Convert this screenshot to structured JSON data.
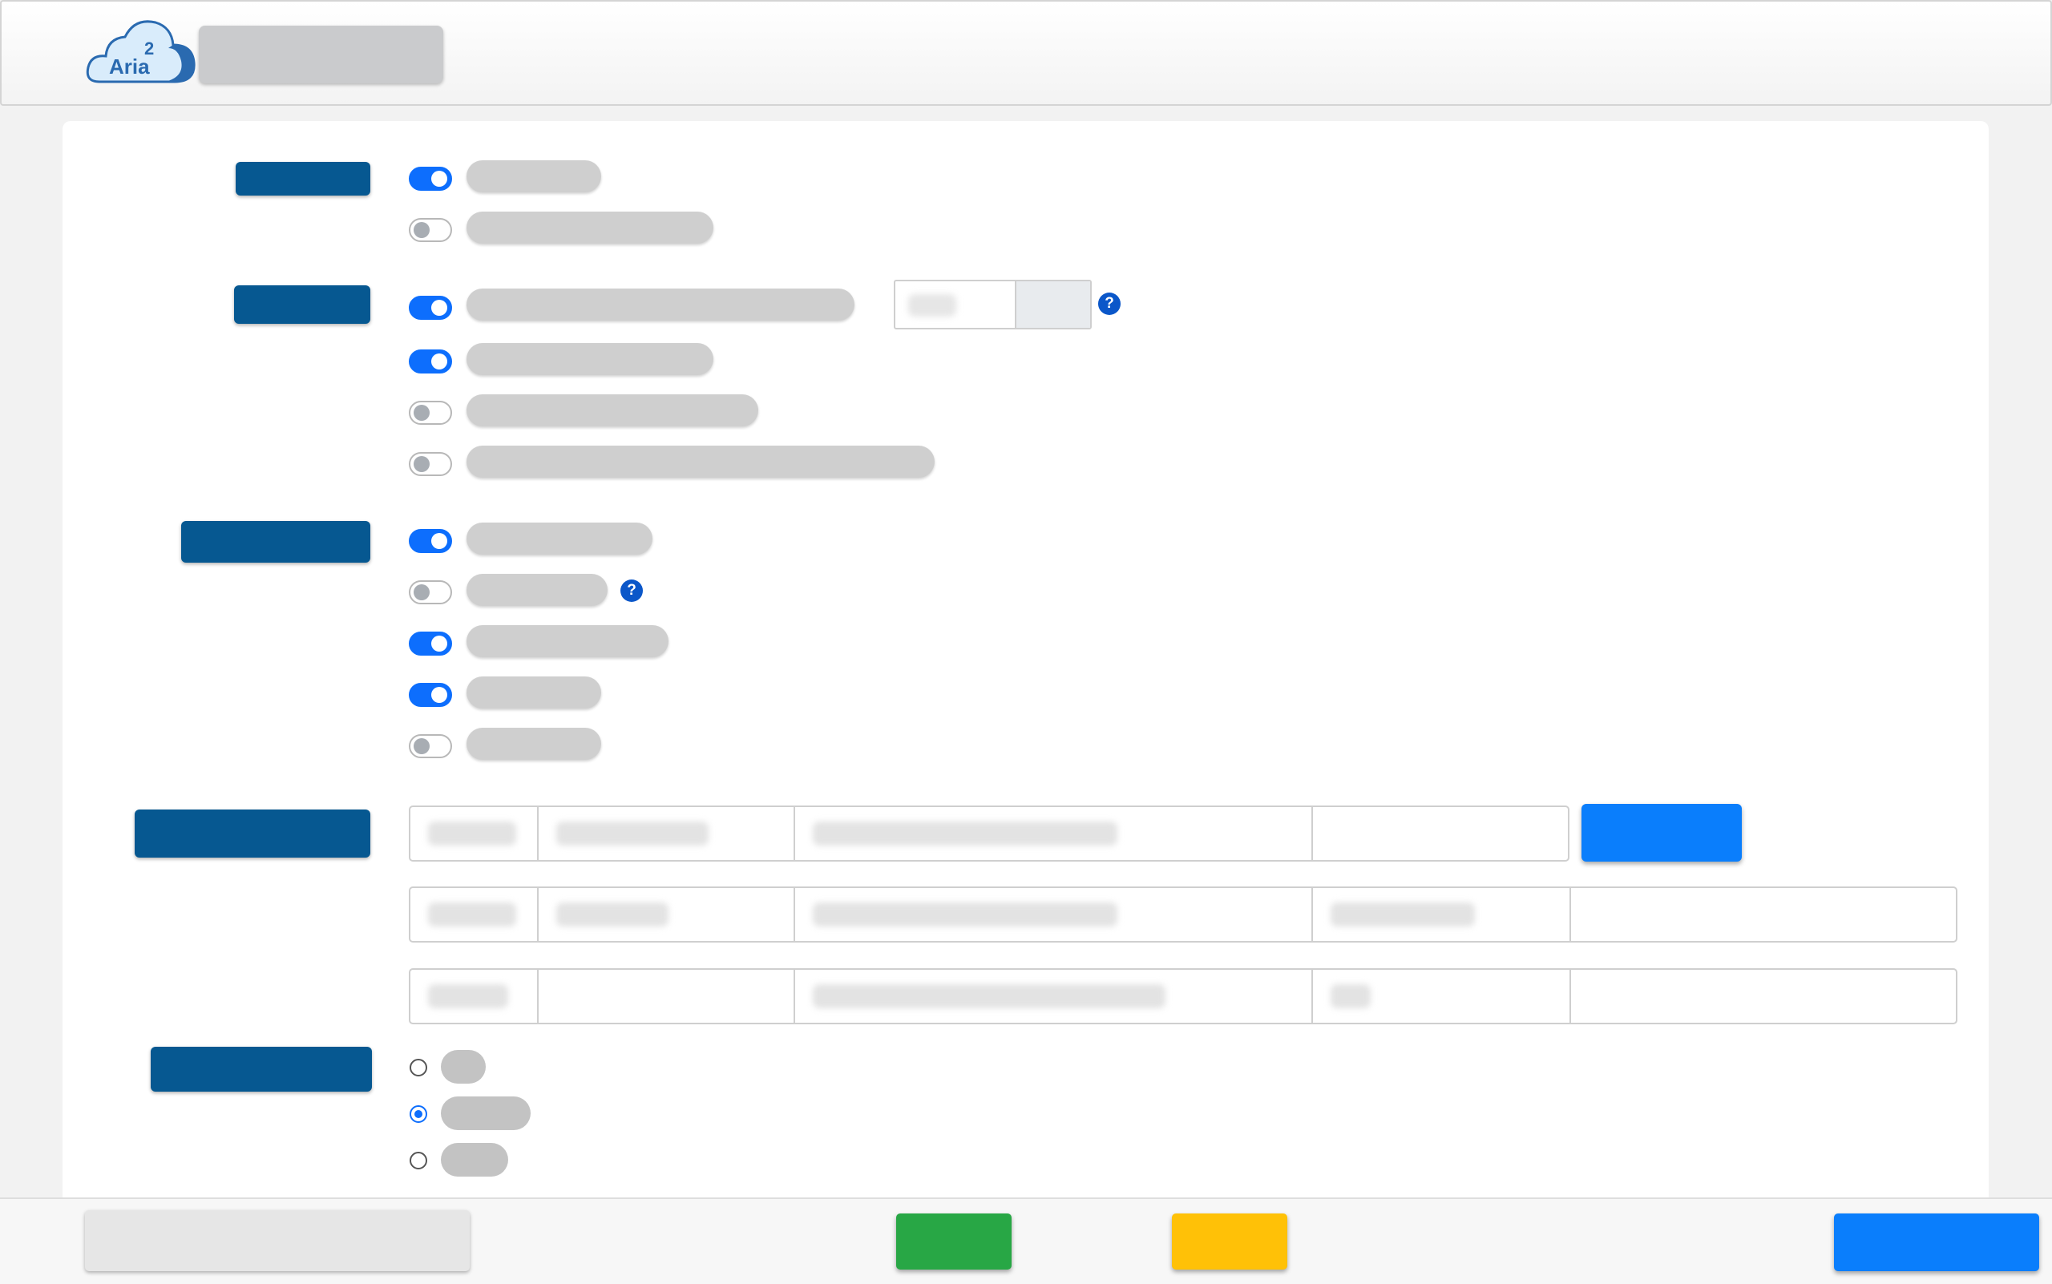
{
  "header": {
    "logo": {
      "icon": "cloud-logo-icon",
      "superscript": "2",
      "text": "Aria"
    }
  },
  "panel": {
    "sections": [
      {
        "id": "section-1",
        "toggles": [
          true,
          false
        ]
      },
      {
        "id": "section-2",
        "toggles": [
          true,
          true,
          false,
          false
        ]
      },
      {
        "id": "section-3",
        "toggles": [
          true,
          false,
          true,
          true,
          false
        ]
      },
      {
        "id": "section-4",
        "rows": 3
      },
      {
        "id": "section-5",
        "radio_options": 3,
        "selected_index": 1
      }
    ],
    "help_icon": "question-mark-icon",
    "help_text": "?"
  },
  "colors": {
    "accent": "#0d6efd",
    "label_bg": "#065891",
    "footer_green": "#28a745",
    "footer_yellow": "#ffc107",
    "footer_blue": "#0a7efc"
  }
}
